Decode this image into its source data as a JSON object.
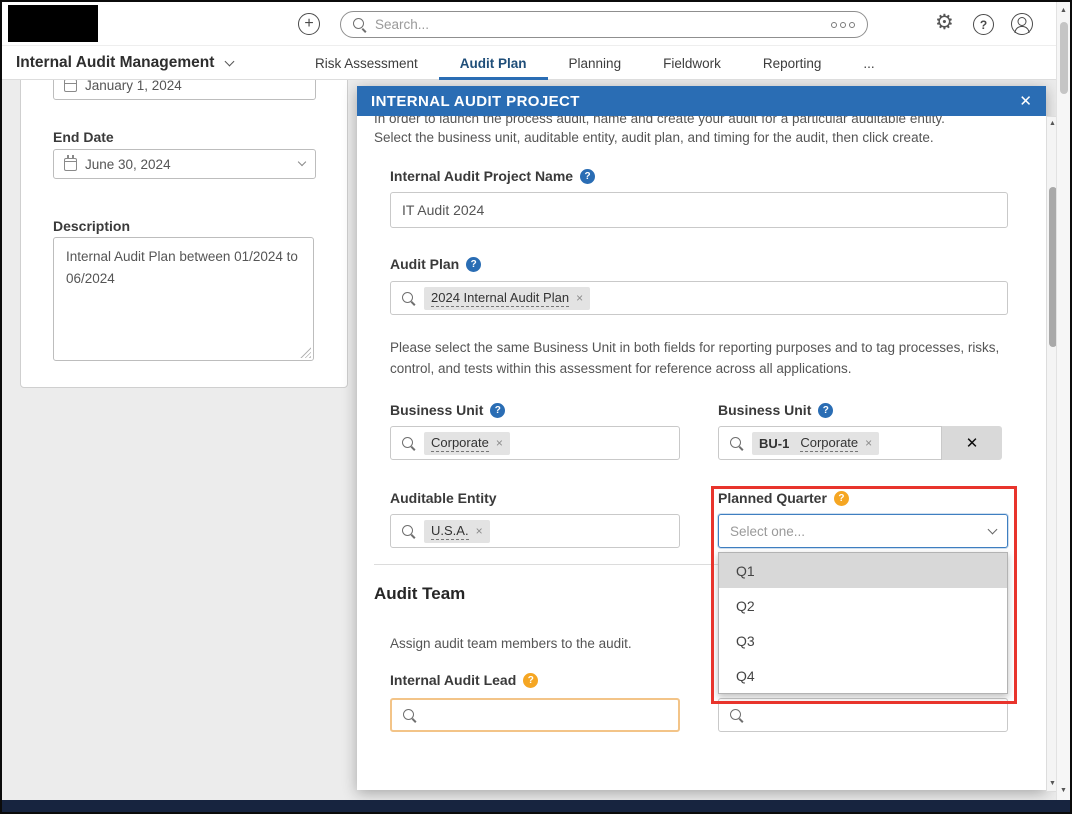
{
  "colors": {
    "accent_blue": "#2A6DB4",
    "help_orange": "#F5A623",
    "annotation_red": "#E8342C"
  },
  "topbar": {
    "search_placeholder": "Search..."
  },
  "nav": {
    "app_title": "Internal Audit Management",
    "tabs": [
      {
        "label": "Risk Assessment"
      },
      {
        "label": "Audit Plan"
      },
      {
        "label": "Planning"
      },
      {
        "label": "Fieldwork"
      },
      {
        "label": "Reporting"
      },
      {
        "label": "..."
      }
    ]
  },
  "left_panel": {
    "start_date_value": "January 1, 2024",
    "end_date_label": "End Date",
    "end_date_value": "June 30, 2024",
    "description_label": "Description",
    "description_value": "Internal Audit Plan between 01/2024 to 06/2024"
  },
  "modal": {
    "title": "INTERNAL AUDIT PROJECT",
    "close_glyph": "✕",
    "intro_line1": "In order to launch the process audit, name and create your audit for a particular auditable entity.",
    "intro_line2": "Select the business unit, auditable entity, audit plan, and timing for the audit, then click create.",
    "project_name_label": "Internal Audit Project Name",
    "project_name_value": "IT Audit 2024",
    "audit_plan_label": "Audit Plan",
    "audit_plan_tag": "2024 Internal Audit Plan",
    "tag_remove_glyph": "×",
    "note": "Please select the same Business Unit in both fields for reporting purposes and to tag processes, risks, control, and tests within this assessment for reference across all applications.",
    "business_unit_left_label": "Business Unit",
    "business_unit_left_tag": "Corporate",
    "business_unit_right_label": "Business Unit",
    "business_unit_right_tag_prefix": "BU-1",
    "business_unit_right_tag": "Corporate",
    "clear_glyph": "✕",
    "auditable_entity_label": "Auditable Entity",
    "auditable_entity_tag": "U.S.A.",
    "planned_quarter": {
      "label": "Planned Quarter",
      "placeholder": "Select one...",
      "options": [
        "Q1",
        "Q2",
        "Q3",
        "Q4"
      ],
      "highlighted": "Q1"
    },
    "audit_team_heading": "Audit Team",
    "audit_team_description": "Assign audit team members to the audit.",
    "internal_audit_lead_label": "Internal Audit Lead"
  }
}
